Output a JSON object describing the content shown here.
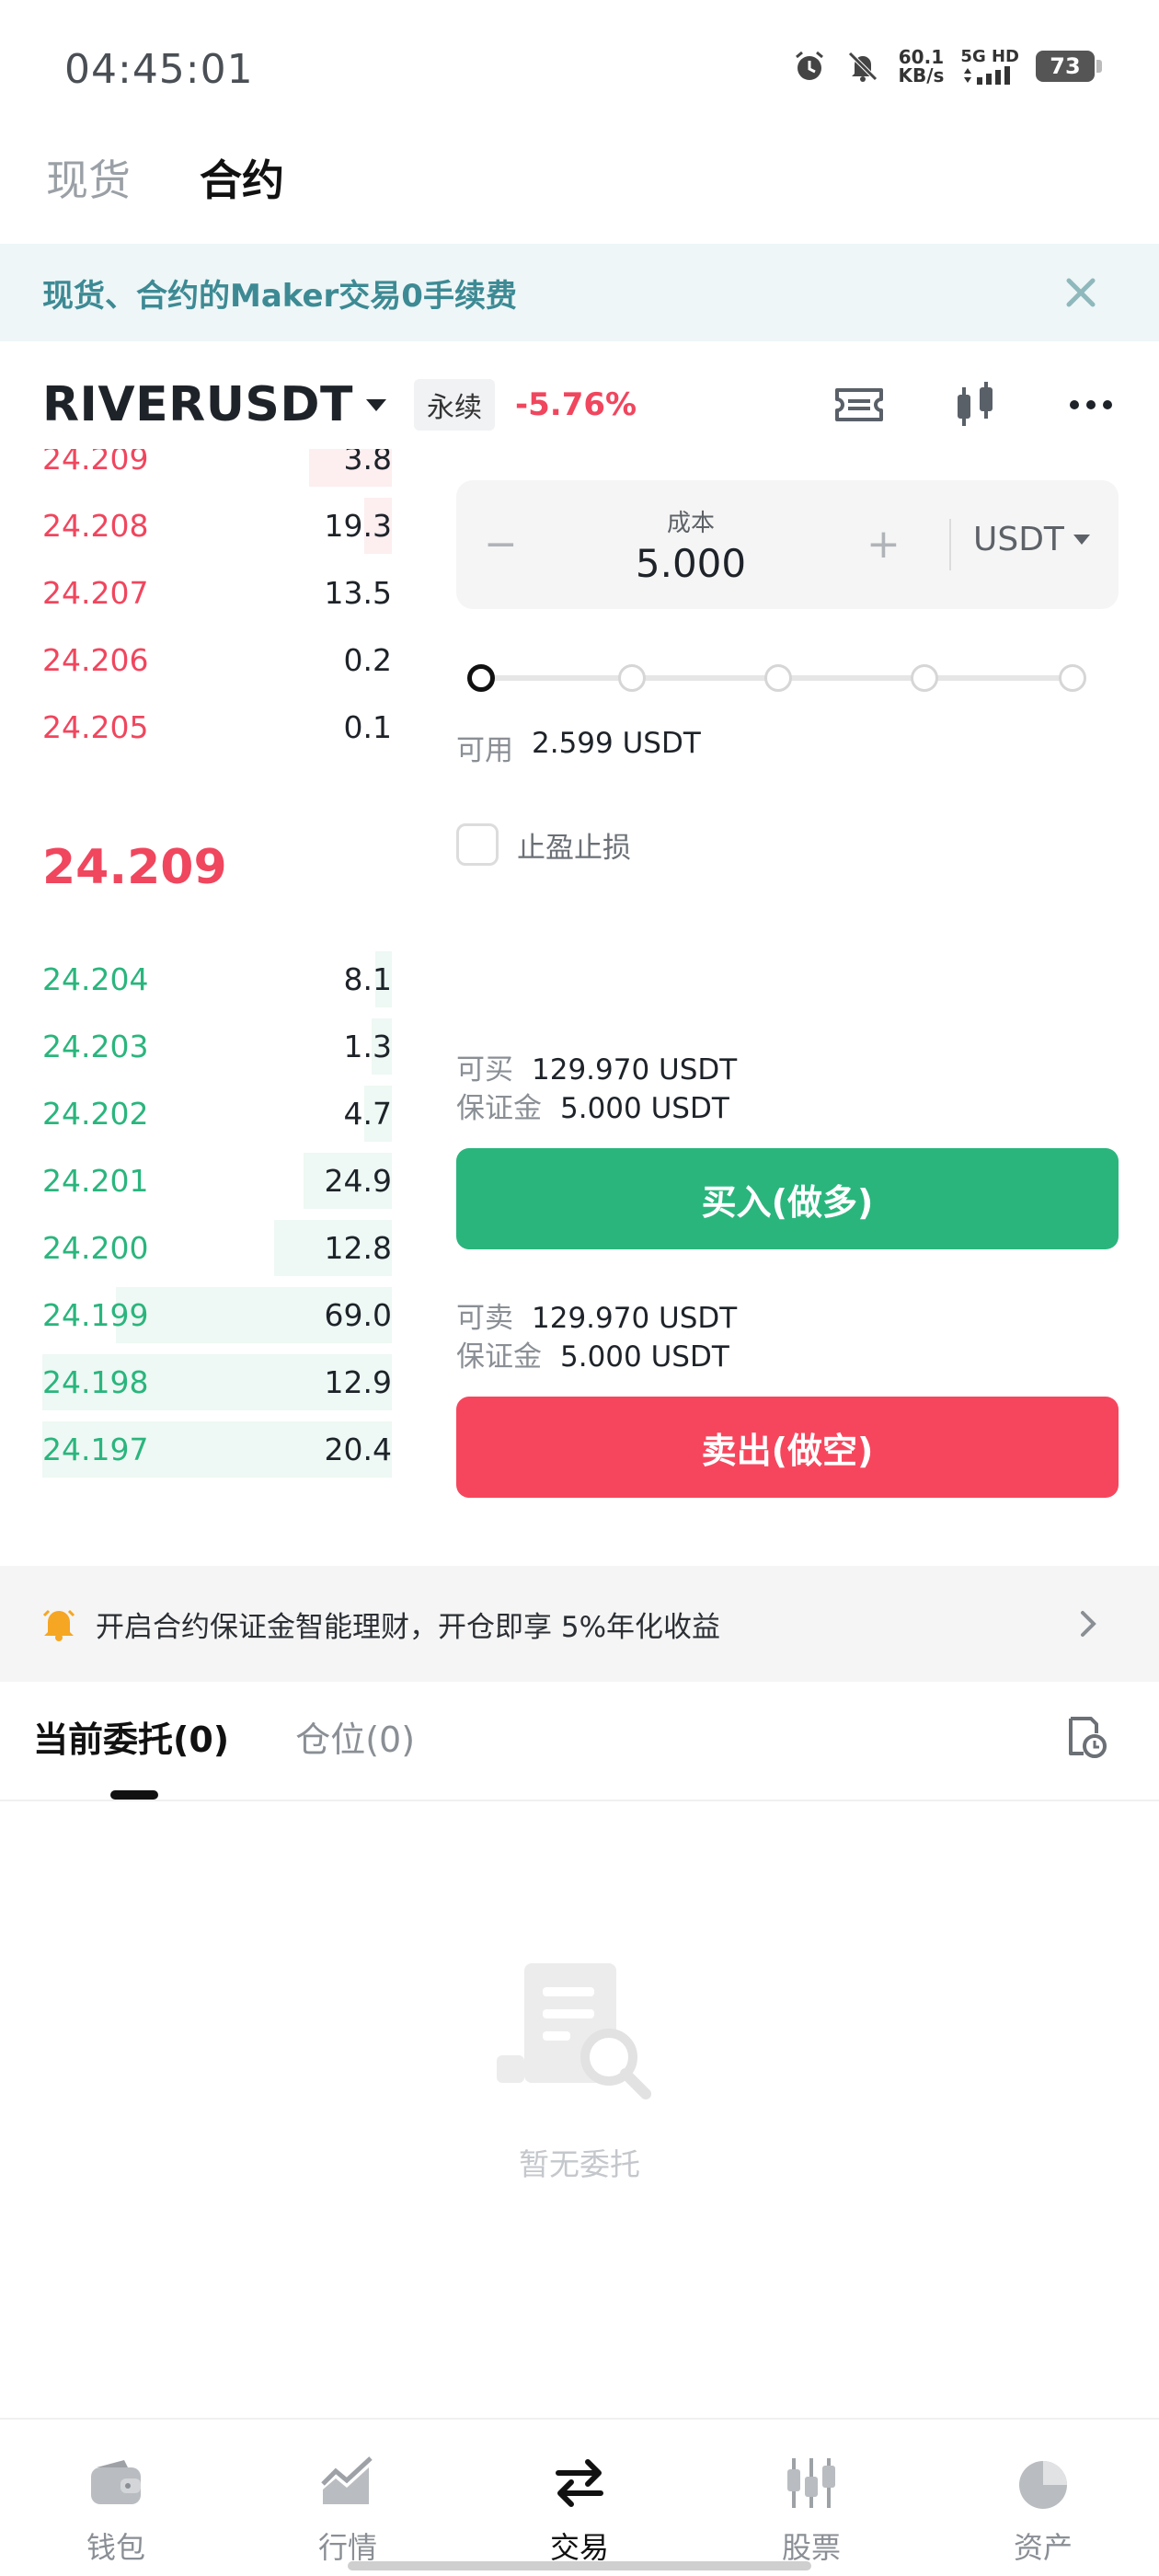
{
  "status_bar": {
    "time": "04:45:01",
    "net_speed_value": "60.1",
    "net_speed_unit": "KB/s",
    "net_type": "5G HD",
    "battery": "73"
  },
  "top_tabs": [
    {
      "label": "现货",
      "active": false
    },
    {
      "label": "合约",
      "active": true
    }
  ],
  "banner": {
    "text": "现货、合约的Maker交易0手续费"
  },
  "pair": {
    "symbol": "RIVERUSDT",
    "badge": "永续",
    "change": "-5.76%"
  },
  "orderbook": {
    "asks": [
      {
        "price": "24.209",
        "qty": "3.8"
      },
      {
        "price": "24.208",
        "qty": "19.3"
      },
      {
        "price": "24.207",
        "qty": "13.5"
      },
      {
        "price": "24.206",
        "qty": "0.2"
      },
      {
        "price": "24.205",
        "qty": "0.1"
      }
    ],
    "last_price": "24.209",
    "bids": [
      {
        "price": "24.204",
        "qty": "8.1"
      },
      {
        "price": "24.203",
        "qty": "1.3"
      },
      {
        "price": "24.202",
        "qty": "4.7"
      },
      {
        "price": "24.201",
        "qty": "24.9"
      },
      {
        "price": "24.200",
        "qty": "12.8"
      },
      {
        "price": "24.199",
        "qty": "69.0"
      },
      {
        "price": "24.198",
        "qty": "12.9"
      },
      {
        "price": "24.197",
        "qty": "20.4"
      }
    ]
  },
  "form": {
    "cost_label": "成本",
    "cost_value": "5.000",
    "minus": "−",
    "plus": "+",
    "unit": "USDT",
    "slider_percent": 0,
    "available_label": "可用",
    "available_value": "2.599 USDT",
    "tpsl_label": "止盈止损",
    "buy_max_label": "可买",
    "buy_max_value": "129.970 USDT",
    "buy_margin_label": "保证金",
    "buy_margin_value": "5.000 USDT",
    "buy_button": "买入(做多)",
    "sell_max_label": "可卖",
    "sell_max_value": "129.970 USDT",
    "sell_margin_label": "保证金",
    "sell_margin_value": "5.000 USDT",
    "sell_button": "卖出(做空)"
  },
  "promo": {
    "text": "开启合约保证金智能理财，开仓即享 5%年化收益",
    "icon": "bell-icon"
  },
  "orders_tabs": [
    {
      "label": "当前委托(0)",
      "active": true
    },
    {
      "label": "仓位(0)",
      "active": false
    }
  ],
  "empty_state": {
    "text": "暂无委托",
    "icon": "empty-document-icon"
  },
  "bottom_nav": [
    {
      "label": "钱包",
      "icon": "wallet-icon",
      "active": false
    },
    {
      "label": "行情",
      "icon": "market-icon",
      "active": false
    },
    {
      "label": "交易",
      "icon": "trade-icon",
      "active": true
    },
    {
      "label": "股票",
      "icon": "stocks-icon",
      "active": false
    },
    {
      "label": "资产",
      "icon": "assets-pie-icon",
      "active": false
    }
  ],
  "colors": {
    "ask": "#f0465e",
    "bid": "#2ab57d",
    "buy_button": "#2ab57d",
    "sell_button": "#f6465d",
    "banner_text": "#3d8a94"
  }
}
